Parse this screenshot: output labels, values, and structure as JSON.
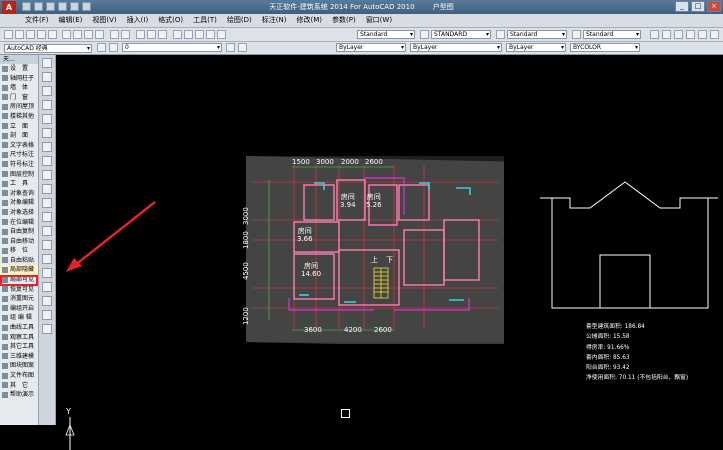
{
  "titlebar": {
    "title": "天正软件-建筑系统 2014  For AutoCAD 2010",
    "mode": "户型图",
    "logo": "A"
  },
  "window_buttons": [
    "_",
    "□",
    "×"
  ],
  "menu": [
    "文件(F)",
    "编辑(E)",
    "视图(V)",
    "插入(I)",
    "格式(O)",
    "工具(T)",
    "绘图(D)",
    "标注(N)",
    "修改(M)",
    "参数(P)",
    "窗口(W)"
  ],
  "toolbar": {
    "workspace": "AutoCAD 经典",
    "layer_value": "0",
    "text_style": "Standard",
    "dim_style": "STANDARD",
    "table_style": "Standard",
    "multileader_style": "Standard",
    "color": "ByLayer",
    "linetype": "ByLayer",
    "lineweight": "ByLayer",
    "plotstyle": "BYCOLOR"
  },
  "left_panel": {
    "header": "天...",
    "items": [
      "设　置",
      "轴网柱子",
      "墙　体",
      "门　窗",
      "房间屋顶",
      "楼梯其他",
      "立　面",
      "剖　面",
      "文字表格",
      "尺寸标注",
      "符号标注",
      "图层控制",
      "工　具",
      "对象查询",
      "对象编辑",
      "对象选择",
      "在位编辑",
      "自由复制",
      "自由移动",
      "移　位",
      "自由粘贴",
      "局部隐藏",
      "局部可见",
      "恢复可见",
      "消重图元",
      "编组开启",
      "组 编 辑",
      "曲线工具",
      "观察工具",
      "其它工具",
      "三维建模",
      "图块图案",
      "文件布图",
      "其　它",
      "帮助演示"
    ],
    "highlighted_index": 21
  },
  "plan": {
    "top_dims": [
      "1500",
      "3000",
      "2000",
      "2600"
    ],
    "bottom_dims": [
      "3600",
      "4200",
      "2600"
    ],
    "left_dims": [
      "3000",
      "1800",
      "4500",
      "1200"
    ],
    "rooms": [
      {
        "name": "房间",
        "area": "3.94"
      },
      {
        "name": "房间",
        "area": "5.26"
      },
      {
        "name": "房间",
        "area": "3.66"
      },
      {
        "name": "房间",
        "area": "14.60"
      }
    ],
    "stair_labels": [
      "上",
      "下"
    ]
  },
  "stats": [
    "套型建筑面积: 186.84",
    "公摊面积: 15.58",
    "得房率: 91.66%",
    "套内面积: 85.63",
    "阳台面积: 93.42",
    "净使用面积: 70.11 (不包括阳台、飘窗)"
  ],
  "ucs_label": "Y",
  "colors": {
    "annotation_red": "#e2242a",
    "canvas": "#000000",
    "wall_pink": "#ff7fb0",
    "window_cyan": "#38d0d8",
    "axis_red": "#ff3030",
    "magenta": "#ff30ff",
    "stair_yellow": "#f0e030"
  }
}
